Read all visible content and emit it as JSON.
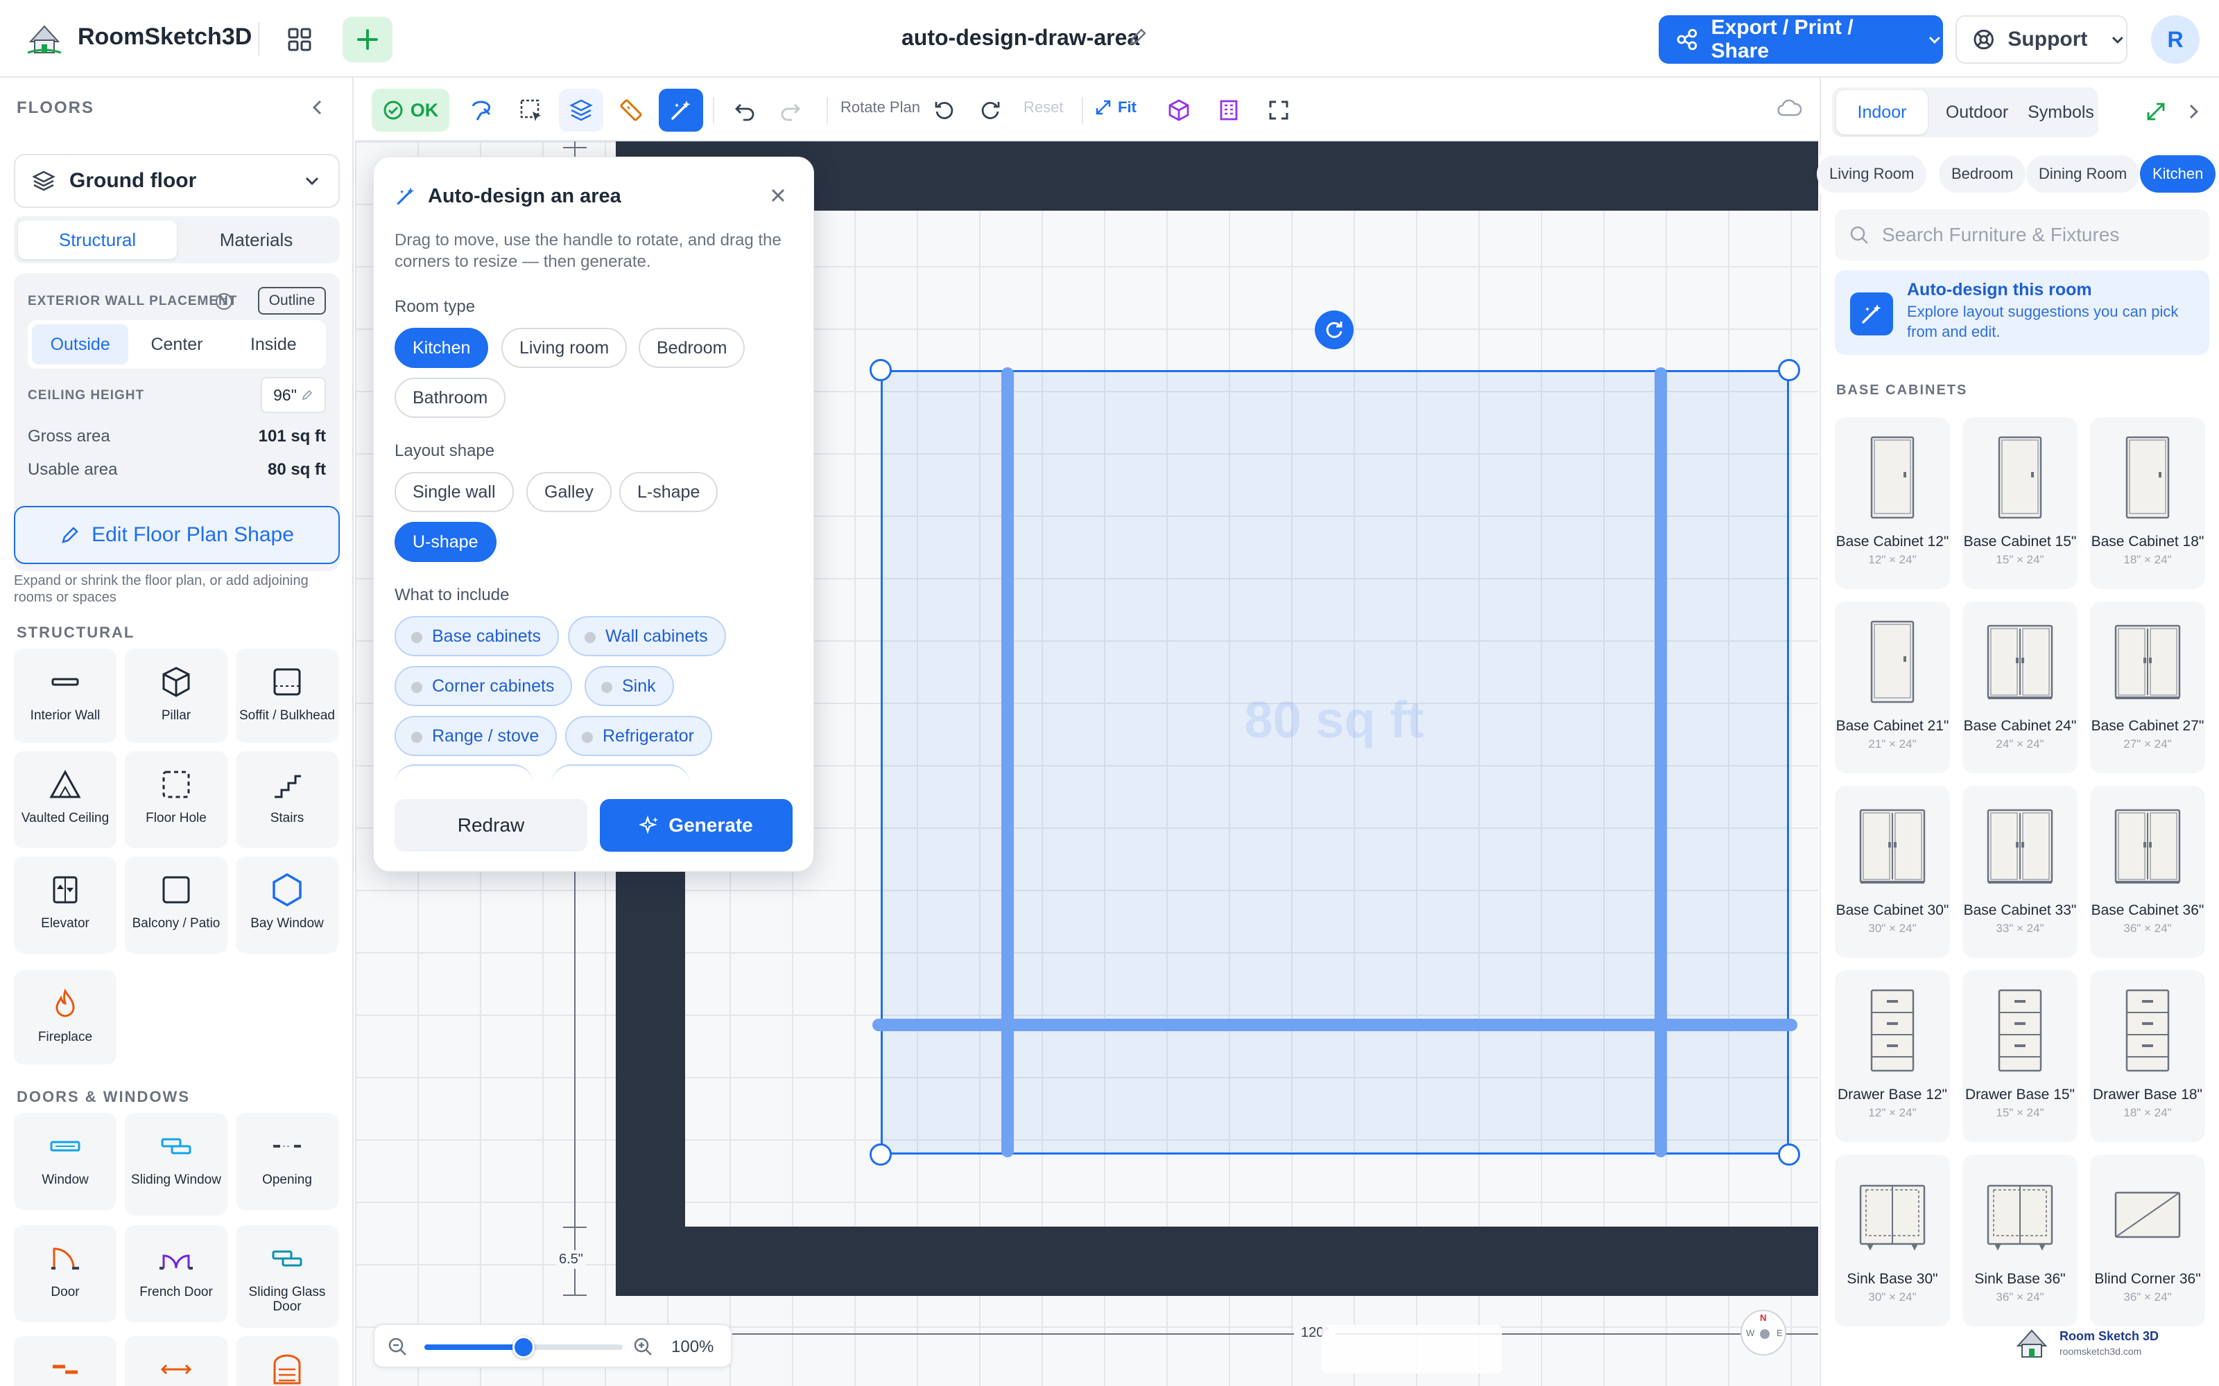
{
  "app": {
    "name": "RoomSketch3D",
    "project_title": "auto-design-draw-area"
  },
  "header": {
    "export_label": "Export / Print / Share",
    "support_label": "Support",
    "avatar_initial": "R"
  },
  "left": {
    "floors_title": "FLOORS",
    "floor_select": "Ground floor",
    "tabs": [
      "Structural",
      "Materials"
    ],
    "wall_placement_label": "EXTERIOR WALL PLACEMENT",
    "outline_label": "Outline",
    "placement_options": [
      "Outside",
      "Center",
      "Inside"
    ],
    "ceiling_label": "CEILING HEIGHT",
    "ceiling_value": "96\"",
    "gross_label": "Gross area",
    "gross_value": "101 sq ft",
    "usable_label": "Usable area",
    "usable_value": "80 sq ft",
    "edit_shape_label": "Edit Floor Plan Shape",
    "edit_hint": "Expand or shrink the floor plan, or add adjoining rooms or spaces",
    "structural_title": "STRUCTURAL",
    "structural_items": [
      {
        "label": "Interior Wall",
        "icon": "interior-wall-icon"
      },
      {
        "label": "Pillar",
        "icon": "pillar-icon"
      },
      {
        "label": "Soffit / Bulkhead",
        "icon": "soffit-icon"
      },
      {
        "label": "Vaulted Ceiling",
        "icon": "vaulted-ceiling-icon"
      },
      {
        "label": "Floor Hole",
        "icon": "floor-hole-icon"
      },
      {
        "label": "Stairs",
        "icon": "stairs-icon"
      },
      {
        "label": "Elevator",
        "icon": "elevator-icon"
      },
      {
        "label": "Balcony / Patio",
        "icon": "balcony-icon"
      },
      {
        "label": "Bay Window",
        "icon": "bay-window-icon"
      },
      {
        "label": "Fireplace",
        "icon": "fireplace-icon"
      }
    ],
    "doors_title": "DOORS & WINDOWS",
    "doors_items": [
      {
        "label": "Window",
        "icon": "window-icon"
      },
      {
        "label": "Sliding Window",
        "icon": "sliding-window-icon"
      },
      {
        "label": "Opening",
        "icon": "opening-icon"
      },
      {
        "label": "Door",
        "icon": "door-icon"
      },
      {
        "label": "French Door",
        "icon": "french-door-icon"
      },
      {
        "label": "Sliding Glass Door",
        "icon": "sliding-glass-door-icon"
      }
    ]
  },
  "toolbar": {
    "ok_label": "OK",
    "rotate_label": "Rotate Plan",
    "reset_label": "Reset",
    "fit_label": "Fit"
  },
  "popover": {
    "title": "Auto-design an area",
    "description": "Drag to move, use the handle to rotate, and drag the corners to resize — then generate.",
    "room_type_label": "Room type",
    "room_types": [
      "Kitchen",
      "Living room",
      "Bedroom",
      "Bathroom"
    ],
    "room_type_selected": "Kitchen",
    "layout_label": "Layout shape",
    "layouts": [
      "Single wall",
      "Galley",
      "L-shape",
      "U-shape"
    ],
    "layout_selected": "U-shape",
    "include_label": "What to include",
    "include_items": [
      "Base cabinets",
      "Wall cabinets",
      "Corner cabinets",
      "Sink",
      "Range / stove",
      "Refrigerator"
    ],
    "redraw_label": "Redraw",
    "generate_label": "Generate"
  },
  "canvas": {
    "area_label": "80 sq ft",
    "dim_vertical": "6.5\"",
    "dim_horizontal": "120\""
  },
  "zoom": {
    "value": "100%",
    "level": 0.5
  },
  "right": {
    "tabs": [
      "Indoor",
      "Outdoor",
      "Symbols"
    ],
    "active_tab": "Indoor",
    "categories": [
      "Living Room",
      "Bedroom",
      "Dining Room",
      "Kitchen"
    ],
    "active_category": "Kitchen",
    "search_placeholder": "Search Furniture & Fixtures",
    "auto_title": "Auto-design this room",
    "auto_desc": "Explore layout suggestions you can pick from and edit.",
    "section_title": "BASE CABINETS",
    "items": [
      {
        "name": "Base Cabinet 12\"",
        "dims": "12\" × 24\"",
        "kind": "single"
      },
      {
        "name": "Base Cabinet 15\"",
        "dims": "15\" × 24\"",
        "kind": "single"
      },
      {
        "name": "Base Cabinet 18\"",
        "dims": "18\" × 24\"",
        "kind": "single"
      },
      {
        "name": "Base Cabinet 21\"",
        "dims": "21\" × 24\"",
        "kind": "single"
      },
      {
        "name": "Base Cabinet 24\"",
        "dims": "24\" × 24\"",
        "kind": "double"
      },
      {
        "name": "Base Cabinet 27\"",
        "dims": "27\" × 24\"",
        "kind": "double"
      },
      {
        "name": "Base Cabinet 30\"",
        "dims": "30\" × 24\"",
        "kind": "double"
      },
      {
        "name": "Base Cabinet 33\"",
        "dims": "33\" × 24\"",
        "kind": "double"
      },
      {
        "name": "Base Cabinet 36\"",
        "dims": "36\" × 24\"",
        "kind": "double"
      },
      {
        "name": "Drawer Base 12\"",
        "dims": "12\" × 24\"",
        "kind": "drawer"
      },
      {
        "name": "Drawer Base 15\"",
        "dims": "15\" × 24\"",
        "kind": "drawer"
      },
      {
        "name": "Drawer Base 18\"",
        "dims": "18\" × 24\"",
        "kind": "drawer"
      },
      {
        "name": "Sink Base 30\"",
        "dims": "30\" × 24\"",
        "kind": "sink"
      },
      {
        "name": "Sink Base 36\"",
        "dims": "36\" × 24\"",
        "kind": "sink"
      },
      {
        "name": "Blind Corner 36\"",
        "dims": "36\" × 24\"",
        "kind": "blind"
      }
    ]
  },
  "watermark": {
    "name": "Room Sketch 3D",
    "url": "roomsketch3d.com"
  },
  "compass": {
    "n": "N",
    "w": "W",
    "e": "E"
  },
  "colors": {
    "accent": "#1d6ef0",
    "wall": "#2b3443",
    "selection": "#1d6ef0"
  }
}
